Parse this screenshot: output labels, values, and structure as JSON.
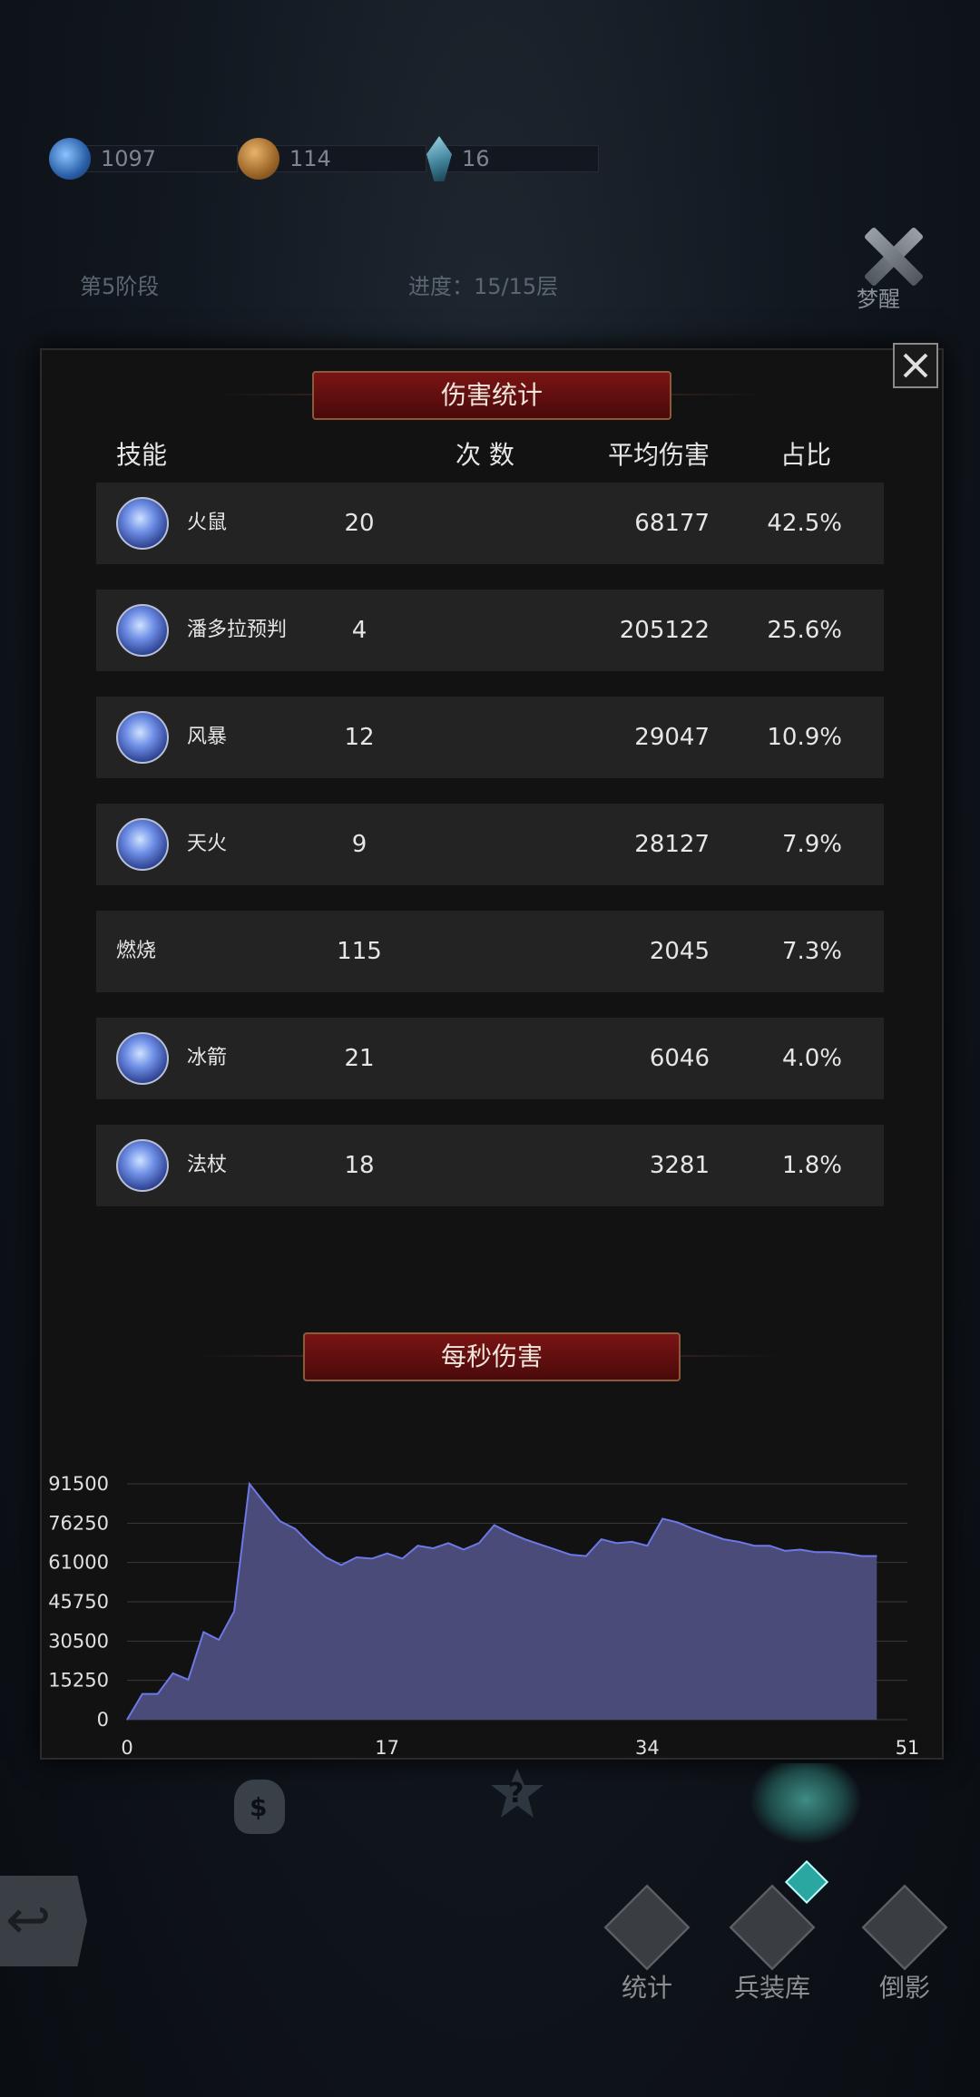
{
  "resources": [
    {
      "icon": "soul-orb-icon",
      "value": "1097"
    },
    {
      "icon": "coin-icon",
      "value": "114"
    },
    {
      "icon": "crystal-icon",
      "value": "16"
    }
  ],
  "stage": {
    "phase": "第5阶段",
    "progress": "进度：15/15层"
  },
  "wake_button": {
    "label": "梦醒"
  },
  "damage_stats": {
    "title": "伤害统计",
    "headers": {
      "skill": "技能",
      "count": "次 数",
      "avg": "平均伤害",
      "ratio": "占比"
    },
    "rows": [
      {
        "icon": "fire-rat-skill-icon",
        "name": "火鼠",
        "count": "20",
        "avg": "68177",
        "ratio": "42.5%"
      },
      {
        "icon": "pandora-foresight-skill-icon",
        "name": "潘多拉预判",
        "count": "4",
        "avg": "205122",
        "ratio": "25.6%"
      },
      {
        "icon": "storm-skill-icon",
        "name": "风暴",
        "count": "12",
        "avg": "29047",
        "ratio": "10.9%"
      },
      {
        "icon": "sky-fire-skill-icon",
        "name": "天火",
        "count": "9",
        "avg": "28127",
        "ratio": "7.9%"
      },
      {
        "icon": "",
        "name": "燃烧",
        "count": "115",
        "avg": "2045",
        "ratio": "7.3%"
      },
      {
        "icon": "ice-arrow-skill-icon",
        "name": "冰箭",
        "count": "21",
        "avg": "6046",
        "ratio": "4.0%"
      },
      {
        "icon": "staff-skill-icon",
        "name": "法杖",
        "count": "18",
        "avg": "3281",
        "ratio": "1.8%"
      }
    ]
  },
  "dps_section": {
    "title": "每秒伤害"
  },
  "chart_data": {
    "type": "area",
    "title": "每秒伤害",
    "xlabel": "",
    "ylabel": "",
    "xlim": [
      0,
      51
    ],
    "ylim": [
      0,
      91500
    ],
    "xticks": [
      "0",
      "17",
      "34",
      "51"
    ],
    "yticks": [
      "91500",
      "76250",
      "61000",
      "45750",
      "30500",
      "15250",
      "0"
    ],
    "grid": true,
    "color": "#4a4b78",
    "line_color": "#6c78e6",
    "x": [
      0,
      1,
      2,
      3,
      4,
      5,
      6,
      7,
      8,
      9,
      10,
      11,
      12,
      13,
      14,
      15,
      16,
      17,
      18,
      19,
      20,
      21,
      22,
      23,
      24,
      25,
      26,
      27,
      28,
      29,
      30,
      31,
      32,
      33,
      34,
      35,
      36,
      37,
      38,
      39,
      40,
      41,
      42,
      43,
      44,
      45,
      46,
      47,
      48,
      49
    ],
    "values": [
      0,
      10000,
      10000,
      18000,
      15500,
      34000,
      31000,
      42000,
      91500,
      84000,
      77000,
      74000,
      68000,
      63000,
      60000,
      63000,
      62500,
      64500,
      62500,
      67500,
      66500,
      68500,
      66000,
      68500,
      75500,
      72500,
      70000,
      68000,
      66000,
      64000,
      63500,
      70000,
      68500,
      69000,
      67500,
      78000,
      76500,
      74000,
      72000,
      70000,
      69000,
      67500,
      67500,
      65500,
      66000,
      65000,
      65000,
      64500,
      63500,
      63500
    ]
  },
  "bottom_nav": [
    {
      "icon": "stats-tab-icon",
      "label": "统计"
    },
    {
      "icon": "armory-tab-icon",
      "label": "兵装库"
    },
    {
      "icon": "shadow-tab-icon",
      "label": "倒影"
    }
  ]
}
